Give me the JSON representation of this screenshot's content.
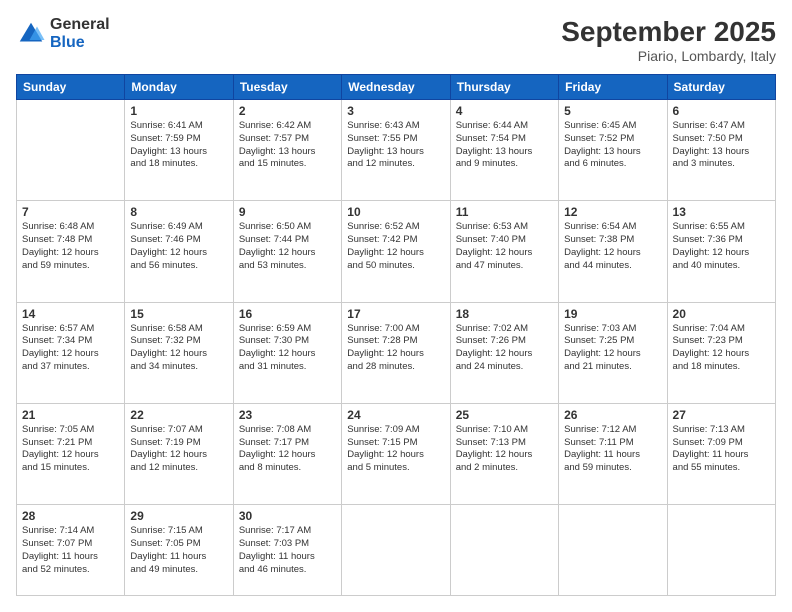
{
  "logo": {
    "general": "General",
    "blue": "Blue"
  },
  "header": {
    "month": "September 2025",
    "location": "Piario, Lombardy, Italy"
  },
  "weekdays": [
    "Sunday",
    "Monday",
    "Tuesday",
    "Wednesday",
    "Thursday",
    "Friday",
    "Saturday"
  ],
  "rows": [
    [
      {
        "day": "",
        "info": ""
      },
      {
        "day": "1",
        "info": "Sunrise: 6:41 AM\nSunset: 7:59 PM\nDaylight: 13 hours\nand 18 minutes."
      },
      {
        "day": "2",
        "info": "Sunrise: 6:42 AM\nSunset: 7:57 PM\nDaylight: 13 hours\nand 15 minutes."
      },
      {
        "day": "3",
        "info": "Sunrise: 6:43 AM\nSunset: 7:55 PM\nDaylight: 13 hours\nand 12 minutes."
      },
      {
        "day": "4",
        "info": "Sunrise: 6:44 AM\nSunset: 7:54 PM\nDaylight: 13 hours\nand 9 minutes."
      },
      {
        "day": "5",
        "info": "Sunrise: 6:45 AM\nSunset: 7:52 PM\nDaylight: 13 hours\nand 6 minutes."
      },
      {
        "day": "6",
        "info": "Sunrise: 6:47 AM\nSunset: 7:50 PM\nDaylight: 13 hours\nand 3 minutes."
      }
    ],
    [
      {
        "day": "7",
        "info": "Sunrise: 6:48 AM\nSunset: 7:48 PM\nDaylight: 12 hours\nand 59 minutes."
      },
      {
        "day": "8",
        "info": "Sunrise: 6:49 AM\nSunset: 7:46 PM\nDaylight: 12 hours\nand 56 minutes."
      },
      {
        "day": "9",
        "info": "Sunrise: 6:50 AM\nSunset: 7:44 PM\nDaylight: 12 hours\nand 53 minutes."
      },
      {
        "day": "10",
        "info": "Sunrise: 6:52 AM\nSunset: 7:42 PM\nDaylight: 12 hours\nand 50 minutes."
      },
      {
        "day": "11",
        "info": "Sunrise: 6:53 AM\nSunset: 7:40 PM\nDaylight: 12 hours\nand 47 minutes."
      },
      {
        "day": "12",
        "info": "Sunrise: 6:54 AM\nSunset: 7:38 PM\nDaylight: 12 hours\nand 44 minutes."
      },
      {
        "day": "13",
        "info": "Sunrise: 6:55 AM\nSunset: 7:36 PM\nDaylight: 12 hours\nand 40 minutes."
      }
    ],
    [
      {
        "day": "14",
        "info": "Sunrise: 6:57 AM\nSunset: 7:34 PM\nDaylight: 12 hours\nand 37 minutes."
      },
      {
        "day": "15",
        "info": "Sunrise: 6:58 AM\nSunset: 7:32 PM\nDaylight: 12 hours\nand 34 minutes."
      },
      {
        "day": "16",
        "info": "Sunrise: 6:59 AM\nSunset: 7:30 PM\nDaylight: 12 hours\nand 31 minutes."
      },
      {
        "day": "17",
        "info": "Sunrise: 7:00 AM\nSunset: 7:28 PM\nDaylight: 12 hours\nand 28 minutes."
      },
      {
        "day": "18",
        "info": "Sunrise: 7:02 AM\nSunset: 7:26 PM\nDaylight: 12 hours\nand 24 minutes."
      },
      {
        "day": "19",
        "info": "Sunrise: 7:03 AM\nSunset: 7:25 PM\nDaylight: 12 hours\nand 21 minutes."
      },
      {
        "day": "20",
        "info": "Sunrise: 7:04 AM\nSunset: 7:23 PM\nDaylight: 12 hours\nand 18 minutes."
      }
    ],
    [
      {
        "day": "21",
        "info": "Sunrise: 7:05 AM\nSunset: 7:21 PM\nDaylight: 12 hours\nand 15 minutes."
      },
      {
        "day": "22",
        "info": "Sunrise: 7:07 AM\nSunset: 7:19 PM\nDaylight: 12 hours\nand 12 minutes."
      },
      {
        "day": "23",
        "info": "Sunrise: 7:08 AM\nSunset: 7:17 PM\nDaylight: 12 hours\nand 8 minutes."
      },
      {
        "day": "24",
        "info": "Sunrise: 7:09 AM\nSunset: 7:15 PM\nDaylight: 12 hours\nand 5 minutes."
      },
      {
        "day": "25",
        "info": "Sunrise: 7:10 AM\nSunset: 7:13 PM\nDaylight: 12 hours\nand 2 minutes."
      },
      {
        "day": "26",
        "info": "Sunrise: 7:12 AM\nSunset: 7:11 PM\nDaylight: 11 hours\nand 59 minutes."
      },
      {
        "day": "27",
        "info": "Sunrise: 7:13 AM\nSunset: 7:09 PM\nDaylight: 11 hours\nand 55 minutes."
      }
    ],
    [
      {
        "day": "28",
        "info": "Sunrise: 7:14 AM\nSunset: 7:07 PM\nDaylight: 11 hours\nand 52 minutes."
      },
      {
        "day": "29",
        "info": "Sunrise: 7:15 AM\nSunset: 7:05 PM\nDaylight: 11 hours\nand 49 minutes."
      },
      {
        "day": "30",
        "info": "Sunrise: 7:17 AM\nSunset: 7:03 PM\nDaylight: 11 hours\nand 46 minutes."
      },
      {
        "day": "",
        "info": ""
      },
      {
        "day": "",
        "info": ""
      },
      {
        "day": "",
        "info": ""
      },
      {
        "day": "",
        "info": ""
      }
    ]
  ]
}
